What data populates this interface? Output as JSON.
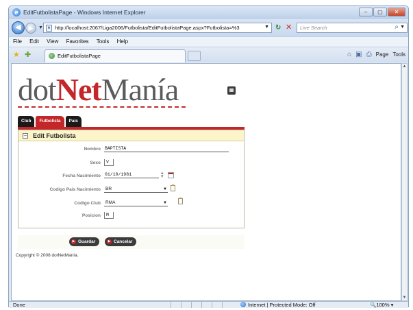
{
  "window": {
    "title": "EditFutbolistaPage - Windows Internet Explorer",
    "controls": {
      "minimize": "–",
      "maximize": "▢",
      "close": "✕"
    }
  },
  "address_bar": {
    "url": "http://localhost:2067/Liga2006/Futbolista/EditFutbolistaPage.aspx?Futbolista=%3",
    "search_placeholder": "Live Search"
  },
  "menu": [
    "File",
    "Edit",
    "View",
    "Favorites",
    "Tools",
    "Help"
  ],
  "browser_tab": {
    "label": "EditFutbolistaPage"
  },
  "command_bar": {
    "page": "Page",
    "tools": "Tools"
  },
  "logo": {
    "part1": "dot",
    "part2": "Net",
    "part3": "Manía"
  },
  "page_tabs": [
    {
      "label": "Club",
      "active": false
    },
    {
      "label": "Futbolista",
      "active": true
    },
    {
      "label": "Pais",
      "active": false
    }
  ],
  "panel": {
    "collapse_symbol": "–",
    "title": "Edit Futbolista"
  },
  "form": {
    "nombre": {
      "label": "Nombre",
      "value": "BAPTISTA"
    },
    "sexo": {
      "label": "Sexo",
      "value": "V"
    },
    "fecha_nacimiento": {
      "label": "Fecha Nacimiento",
      "value": "01/10/1981"
    },
    "codigo_pais": {
      "label": "Codigo Pais Nacimiento",
      "value": "BR"
    },
    "codigo_club": {
      "label": "Codigo Club",
      "value": "RMA"
    },
    "posicion": {
      "label": "Posicion",
      "value": "M"
    }
  },
  "buttons": {
    "save": "Guardar",
    "cancel": "Cancelar"
  },
  "footer": {
    "copyright": "Copyright © 2008 dotNetManía."
  },
  "status_bar": {
    "status": "Done",
    "zone": "Internet | Protected Mode: Off",
    "zoom": "100%"
  },
  "colors": {
    "brand_red": "#c4272a",
    "panel_header": "#fbf5c9"
  }
}
